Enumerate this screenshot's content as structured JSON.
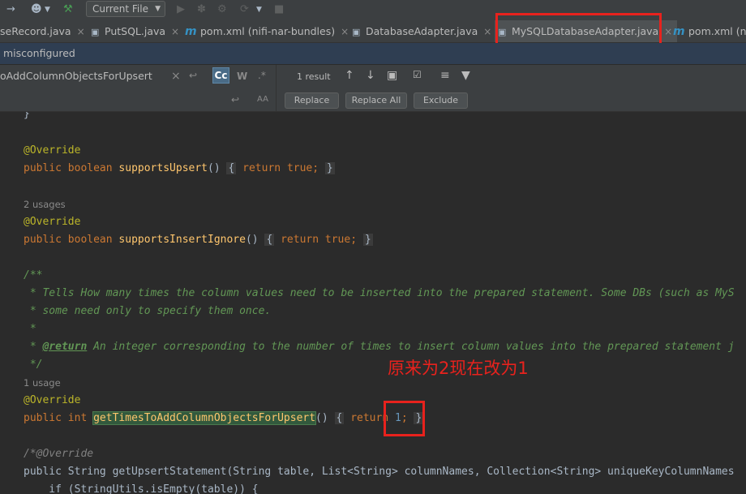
{
  "toolbar": {
    "run_config": "Current File"
  },
  "tabs": [
    {
      "label": "seRecord.java",
      "icon": "java-class-icon"
    },
    {
      "label": "PutSQL.java",
      "icon": "java-class-icon"
    },
    {
      "label": "pom.xml (nifi-nar-bundles)",
      "icon": "maven-icon"
    },
    {
      "label": "DatabaseAdapter.java",
      "icon": "java-interface-icon"
    },
    {
      "label": "MySQLDatabaseAdapter.java",
      "icon": "java-class-icon"
    },
    {
      "label": "pom.xml (nifi",
      "icon": "maven-icon"
    }
  ],
  "notice": "misconfigured",
  "find": {
    "query": "oAddColumnObjectsForUpsert",
    "case_toggle": "Cc",
    "word_toggle": "W",
    "regex_toggle": ".*",
    "result_count": "1 result",
    "replace_button": "Replace",
    "replace_all_button": "Replace All",
    "exclude_button": "Exclude",
    "preserve_case": "AA"
  },
  "code": {
    "brace_close": "}",
    "override": "@Override",
    "public": "public",
    "boolean": "boolean",
    "int": "int",
    "fn_supports_upsert": "supportsUpsert",
    "fn_supports_insert_ignore": "supportsInsertIgnore",
    "fn_get_times": "getTimesToAddColumnObjectsForUpsert",
    "parens": "()",
    "return_kw": "return",
    "true_kw": "true",
    "semicolon": ";",
    "open_brace": "{",
    "close_brace": "}",
    "return_value": "1",
    "usages_2": "2 usages",
    "usages_1": "1 usage",
    "doc_start": "/**",
    "doc_line1": " * Tells How many times the column values need to be inserted into the prepared statement. Some DBs (such as MyS",
    "doc_line2": " * some need only to specify them once.",
    "doc_line3": " *",
    "doc_line4_prefix": " * ",
    "doc_return_tag": "@return",
    "doc_line4_rest": " An integer corresponding to the number of times to insert column values into the prepared statement j",
    "doc_end": " */",
    "comment_override": "/*@Override",
    "get_upsert_line": "public String getUpsertStatement(String table, List<String> columnNames, Collection<String> uniqueKeyColumnNames",
    "if_line": "    if (StringUtils.isEmpty(table)) {"
  },
  "annotation_note": "原来为2现在改为1",
  "colors": {
    "annotation_red": "#e8221d",
    "keyword": "#cc7832",
    "function": "#ffc66d",
    "javadoc": "#629755"
  }
}
